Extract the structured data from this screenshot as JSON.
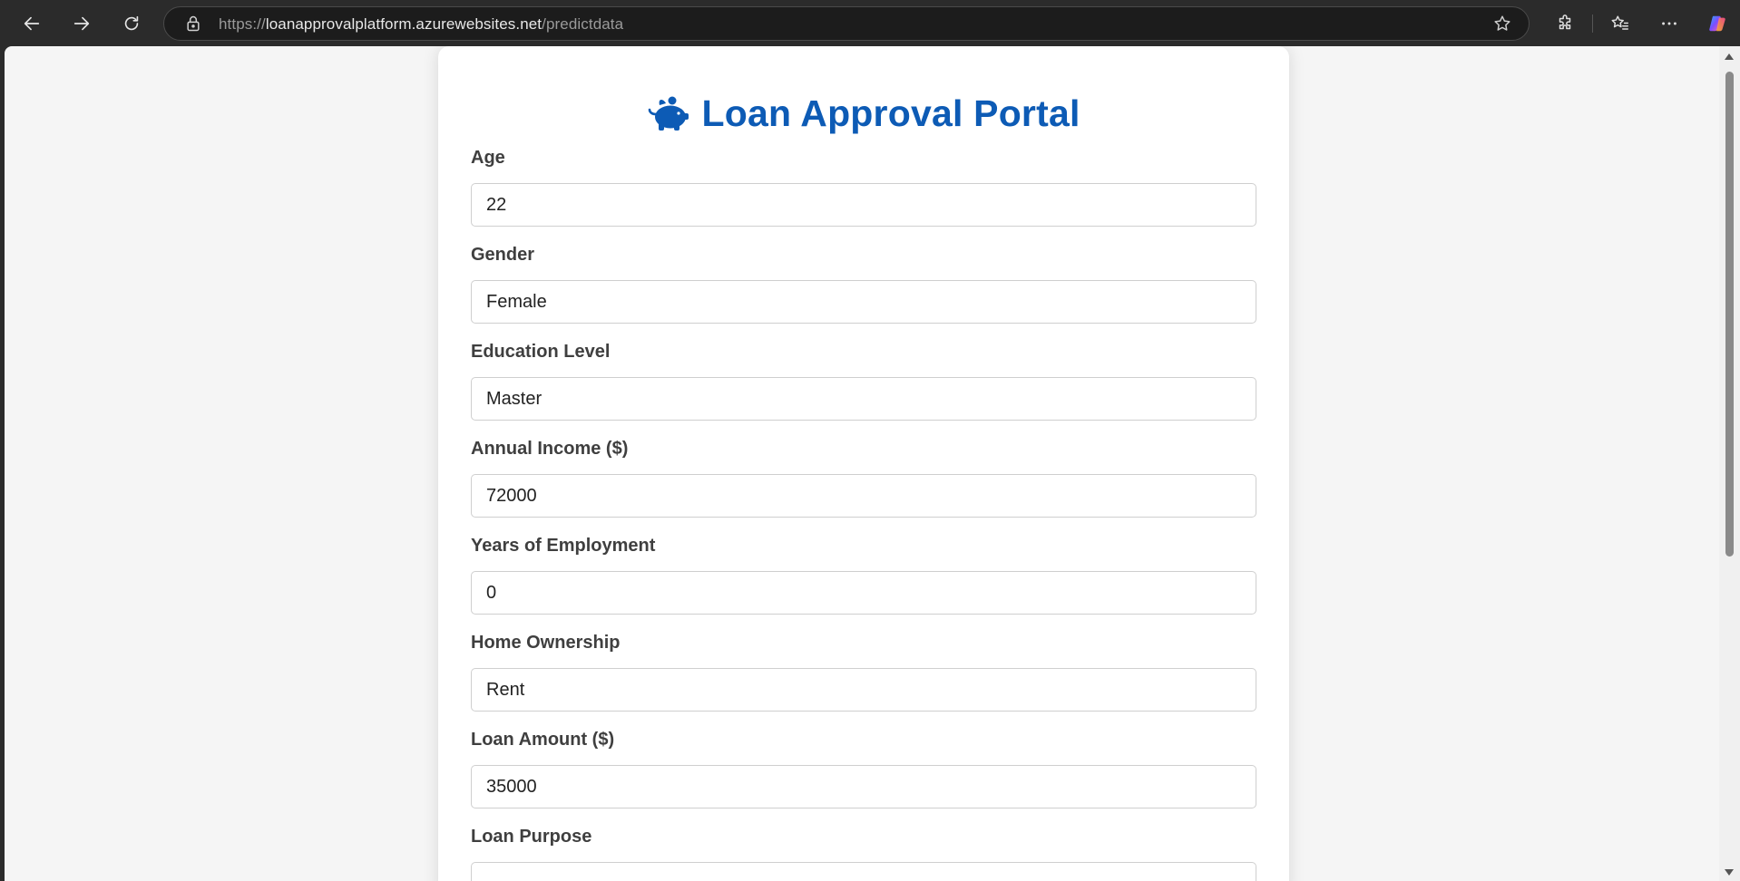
{
  "browser": {
    "url_prefix": "https://",
    "url_host": "loanapprovalplatform.azurewebsites.net",
    "url_path": "/predictdata"
  },
  "page": {
    "title": "Loan Approval Portal",
    "title_color": "#0d5bb5",
    "fields": [
      {
        "label": "Age",
        "value": "22"
      },
      {
        "label": "Gender",
        "value": "Female"
      },
      {
        "label": "Education Level",
        "value": "Master"
      },
      {
        "label": "Annual Income ($)",
        "value": "72000"
      },
      {
        "label": "Years of Employment",
        "value": "0"
      },
      {
        "label": "Home Ownership",
        "value": "Rent"
      },
      {
        "label": "Loan Amount ($)",
        "value": "35000"
      },
      {
        "label": "Loan Purpose",
        "value": ""
      }
    ]
  }
}
